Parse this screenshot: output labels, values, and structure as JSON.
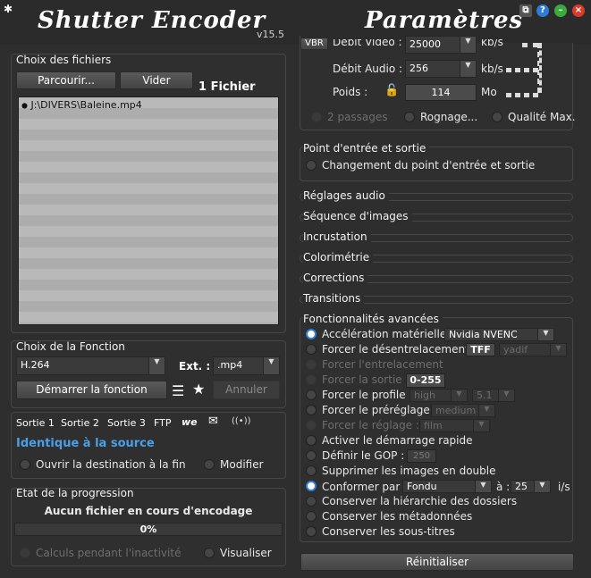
{
  "app": {
    "name": "Shutter Encoder",
    "version": "v15.5",
    "settings_title": "Paramètres"
  },
  "files": {
    "title": "Choix des fichiers",
    "browse": "Parcourir...",
    "clear": "Vider",
    "count": "1 Fichier",
    "items": [
      "J:\\DIVERS\\Baleine.mp4"
    ]
  },
  "function": {
    "title": "Choix de la Fonction",
    "codec": "H.264",
    "ext_label": "Ext. :",
    "ext_value": ".mp4",
    "start": "Démarrer la fonction",
    "cancel": "Annuler"
  },
  "output": {
    "tabs": [
      "Sortie 1",
      "Sortie 2",
      "Sortie 3",
      "FTP"
    ],
    "destination": "Identique à la source",
    "open_dest": "Ouvrir la destination à la fin",
    "modify": "Modifier"
  },
  "progress": {
    "title": "Etat de la progression",
    "status": "Aucun fichier en cours d'encodage",
    "percent": "0%",
    "percent_value": 0,
    "idle_calc": "Calculs pendant l'inactivité",
    "visualize": "Visualiser"
  },
  "bitrate": {
    "video_label": "Débit Vidéo :",
    "video_value": "25000",
    "video_unit": "kb/s",
    "audio_label": "Débit Audio :",
    "audio_value": "256",
    "audio_unit": "kb/s",
    "size_label": "Poids :",
    "size_value": "114",
    "size_unit": "Mo",
    "vbr": "VBR",
    "two_pass": "2 passages",
    "crop": "Rognage...",
    "max_quality": "Qualité Max."
  },
  "inout": {
    "title": "Point d'entrée et sortie",
    "option": "Changement du point d'entrée et sortie"
  },
  "sections": [
    "Réglages audio",
    "Séquence d'images",
    "Incrustation",
    "Colorimétrie",
    "Corrections",
    "Transitions"
  ],
  "advanced": {
    "title": "Fonctionnalités avancées",
    "hw_accel": "Accélération matérielle :",
    "hw_value": "Nvidia NVENC",
    "deinterlace": "Forcer le désentrelacement :",
    "tff": "TFF",
    "yadif": "yadif",
    "interlace": "Forcer l'entrelacement",
    "output_range": "Forcer la sortie :",
    "range_value": "0-255",
    "profile": "Forcer le profile :",
    "profile_value": "high",
    "level_value": "5.1",
    "preset": "Forcer le préréglage :",
    "preset_value": "medium",
    "tune": "Forcer le réglage :",
    "tune_value": "film",
    "fast_start": "Activer le démarrage rapide",
    "gop": "Définir le GOP :",
    "gop_value": "250",
    "dedup": "Supprimer les images en double",
    "conform": "Conformer par :",
    "conform_value": "Fondu",
    "conform_at": "à :",
    "fps_value": "25",
    "fps_unit": "i/s",
    "keep_hierarchy": "Conserver la hiérarchie des dossiers",
    "keep_metadata": "Conserver les métadonnées",
    "keep_subtitles": "Conserver les sous-titres"
  },
  "reset": "Réinitialiser",
  "colors": {
    "accent": "#2f7cd6",
    "link": "#4aa0e8",
    "bg": "#2e2e2e"
  }
}
